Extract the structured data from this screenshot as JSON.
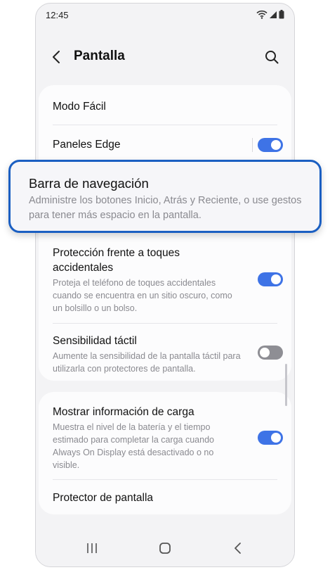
{
  "status_bar": {
    "time": "12:45"
  },
  "header": {
    "title": "Pantalla"
  },
  "settings": {
    "easy_mode": {
      "title": "Modo Fácil"
    },
    "edge_panels": {
      "title": "Paneles Edge",
      "enabled": true
    },
    "navigation_bar": {
      "title": "Barra de navegación",
      "subtitle": "Administre los botones Inicio, Atrás y Reciente, o use gestos para tener más espacio en la pantalla."
    },
    "accidental_touch": {
      "title": "Protección frente a toques accidentales",
      "subtitle": "Proteja el teléfono de toques accidentales cuando se encuentra en un sitio oscuro, como un bolsillo o un bolso.",
      "enabled": true
    },
    "touch_sensitivity": {
      "title": "Sensibilidad táctil",
      "subtitle": "Aumente la sensibilidad de la pantalla táctil para utilizarla con protectores de pantalla.",
      "enabled": false
    },
    "charging_info": {
      "title": "Mostrar información de carga",
      "subtitle": "Muestra el nivel de la batería y el tiempo estimado para completar la carga cuando Always On Display está desactivado o no visible.",
      "enabled": true
    },
    "screen_saver": {
      "title": "Protector de pantalla"
    }
  },
  "colors": {
    "accent": "#3e73e6",
    "highlight_border": "#1b5fc2",
    "toggle_off": "#8e8e94"
  }
}
